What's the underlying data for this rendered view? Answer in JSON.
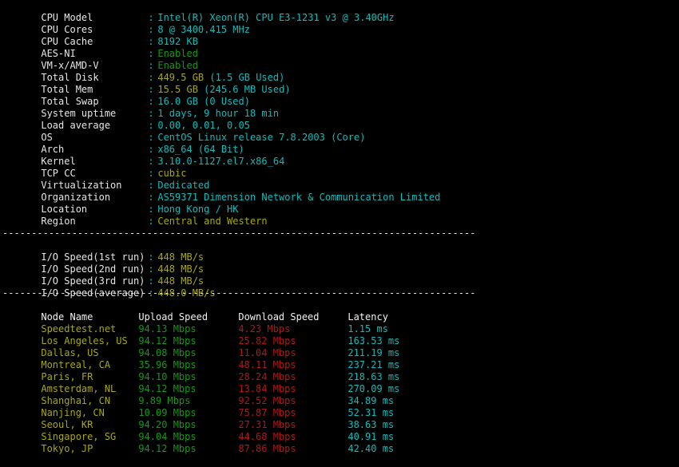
{
  "terminal": {
    "background": "#000000",
    "colors": {
      "label": "#e6e6e6",
      "value_cyan": "#0dbcbc",
      "value_gold": "#a8a80b",
      "value_green": "#119911",
      "value_red": "#b01717",
      "header_white": "#f0f0f0"
    },
    "separator": "----------------------------------------------------------------------"
  },
  "sysinfo": {
    "rows": [
      {
        "label": "CPU Model",
        "colon": ":",
        "value": "Intel(R) Xeon(R) CPU E3-1231 v3 @ 3.40GHz"
      },
      {
        "label": "CPU Cores",
        "colon": ":",
        "value": "8 @ 3400.415 MHz"
      },
      {
        "label": "CPU Cache",
        "colon": ":",
        "value": "8192 KB"
      },
      {
        "label": "AES-NI",
        "colon": ":",
        "value": "Enabled"
      },
      {
        "label": "VM-x/AMD-V",
        "colon": ":",
        "value": "Enabled"
      },
      {
        "label": "Total Disk",
        "colon": ":",
        "value_main": "449.5 GB",
        "value_extra": "(1.5 GB Used)"
      },
      {
        "label": "Total Mem",
        "colon": ":",
        "value_main": "15.5 GB",
        "value_extra": "(245.6 MB Used)"
      },
      {
        "label": "Total Swap",
        "colon": ":",
        "value_main": "16.0 GB",
        "value_extra": "(0 Used)"
      },
      {
        "label": "System uptime",
        "colon": ":",
        "value": "1 days, 9 hour 18 min"
      },
      {
        "label": "Load average",
        "colon": ":",
        "value": "0.00, 0.01, 0.05"
      },
      {
        "label": "OS",
        "colon": ":",
        "value": "CentOS Linux release 7.8.2003 (Core)"
      },
      {
        "label": "Arch",
        "colon": ":",
        "value": "x86_64 (64 Bit)"
      },
      {
        "label": "Kernel",
        "colon": ":",
        "value": "3.10.0-1127.el7.x86_64"
      },
      {
        "label": "TCP CC",
        "colon": ":",
        "value": "cubic"
      },
      {
        "label": "Virtualization",
        "colon": ":",
        "value": "Dedicated"
      },
      {
        "label": "Organization",
        "colon": ":",
        "value": "AS59371 Dimension Network & Communication Limited"
      },
      {
        "label": "Location",
        "colon": ":",
        "value": "Hong Kong / HK"
      },
      {
        "label": "Region",
        "colon": ":",
        "value": "Central and Western"
      }
    ]
  },
  "iospeed": {
    "rows": [
      {
        "label": "I/O Speed(1st run)",
        "colon": ":",
        "value": "448 MB/s"
      },
      {
        "label": "I/O Speed(2nd run)",
        "colon": ":",
        "value": "448 MB/s"
      },
      {
        "label": "I/O Speed(3rd run)",
        "colon": ":",
        "value": "448 MB/s"
      },
      {
        "label": "I/O Speed(average)",
        "colon": ":",
        "value": "448.0 MB/s"
      }
    ]
  },
  "speedtest": {
    "headers": {
      "node": "Node Name",
      "upload": "Upload Speed",
      "download": "Download Speed",
      "latency": "Latency"
    },
    "rows": [
      {
        "node": "Speedtest.net",
        "upload": "94.13 Mbps",
        "download": "4.23 Mbps",
        "latency": "1.15 ms"
      },
      {
        "node": "Los Angeles, US",
        "upload": "94.12 Mbps",
        "download": "25.82 Mbps",
        "latency": "163.53 ms"
      },
      {
        "node": "Dallas, US",
        "upload": "94.08 Mbps",
        "download": "11.04 Mbps",
        "latency": "211.19 ms"
      },
      {
        "node": "Montreal, CA",
        "upload": "35.96 Mbps",
        "download": "48.11 Mbps",
        "latency": "237.21 ms"
      },
      {
        "node": "Paris, FR",
        "upload": "94.10 Mbps",
        "download": "28.24 Mbps",
        "latency": "218.63 ms"
      },
      {
        "node": "Amsterdam, NL",
        "upload": "94.12 Mbps",
        "download": "13.84 Mbps",
        "latency": "270.09 ms"
      },
      {
        "node": "Shanghai, CN",
        "upload": "9.89 Mbps",
        "download": "92.52 Mbps",
        "latency": "34.89 ms"
      },
      {
        "node": "Nanjing, CN",
        "upload": "10.09 Mbps",
        "download": "75.87 Mbps",
        "latency": "52.31 ms"
      },
      {
        "node": "Seoul, KR",
        "upload": "94.20 Mbps",
        "download": "27.31 Mbps",
        "latency": "38.63 ms"
      },
      {
        "node": "Singapore, SG",
        "upload": "94.04 Mbps",
        "download": "44.68 Mbps",
        "latency": "40.91 ms"
      },
      {
        "node": "Tokyo, JP",
        "upload": "94.12 Mbps",
        "download": "87.86 Mbps",
        "latency": "42.40 ms"
      }
    ]
  }
}
